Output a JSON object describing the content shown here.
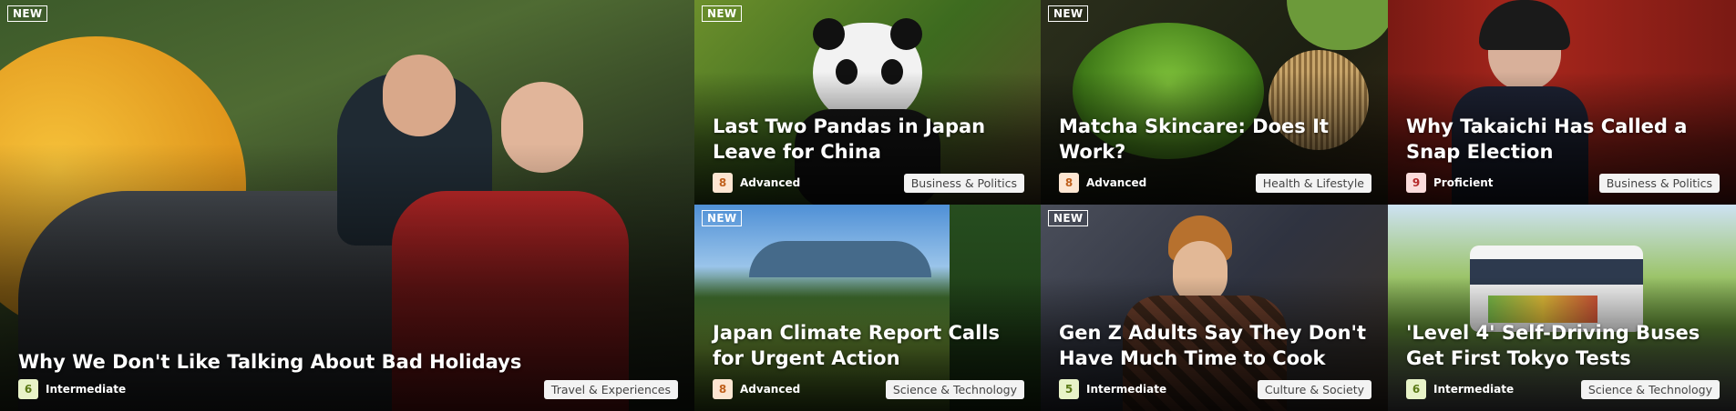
{
  "new_badge": "NEW",
  "cards": [
    {
      "title": "Why We Don't Like Talking About Bad Holidays",
      "level": "6",
      "level_label": "Intermediate",
      "category": "Travel & Experiences",
      "is_new": true,
      "level_color": "#e8f3c8"
    },
    {
      "title": "Last Two Pandas in Japan Leave for China",
      "level": "8",
      "level_label": "Advanced",
      "category": "Business & Politics",
      "is_new": true,
      "level_color": "#fde6d2"
    },
    {
      "title": "Matcha Skincare: Does It Work?",
      "level": "8",
      "level_label": "Advanced",
      "category": "Health & Lifestyle",
      "is_new": true,
      "level_color": "#fde6d2"
    },
    {
      "title": "Why Takaichi Has Called a Snap Election",
      "level": "9",
      "level_label": "Proficient",
      "category": "Business & Politics",
      "is_new": false,
      "level_color": "#fbdcdc"
    },
    {
      "title": "Japan Climate Report Calls for Urgent Action",
      "level": "8",
      "level_label": "Advanced",
      "category": "Science & Technology",
      "is_new": true,
      "level_color": "#fde6d2"
    },
    {
      "title": "Gen Z Adults Say They Don't Have Much Time to Cook",
      "level": "5",
      "level_label": "Intermediate",
      "category": "Culture & Society",
      "is_new": true,
      "level_color": "#e8f3c8"
    },
    {
      "title": "'Level 4' Self-Driving Buses Get First Tokyo Tests",
      "level": "6",
      "level_label": "Intermediate",
      "category": "Science & Technology",
      "is_new": false,
      "level_color": "#e8f3c8"
    }
  ]
}
